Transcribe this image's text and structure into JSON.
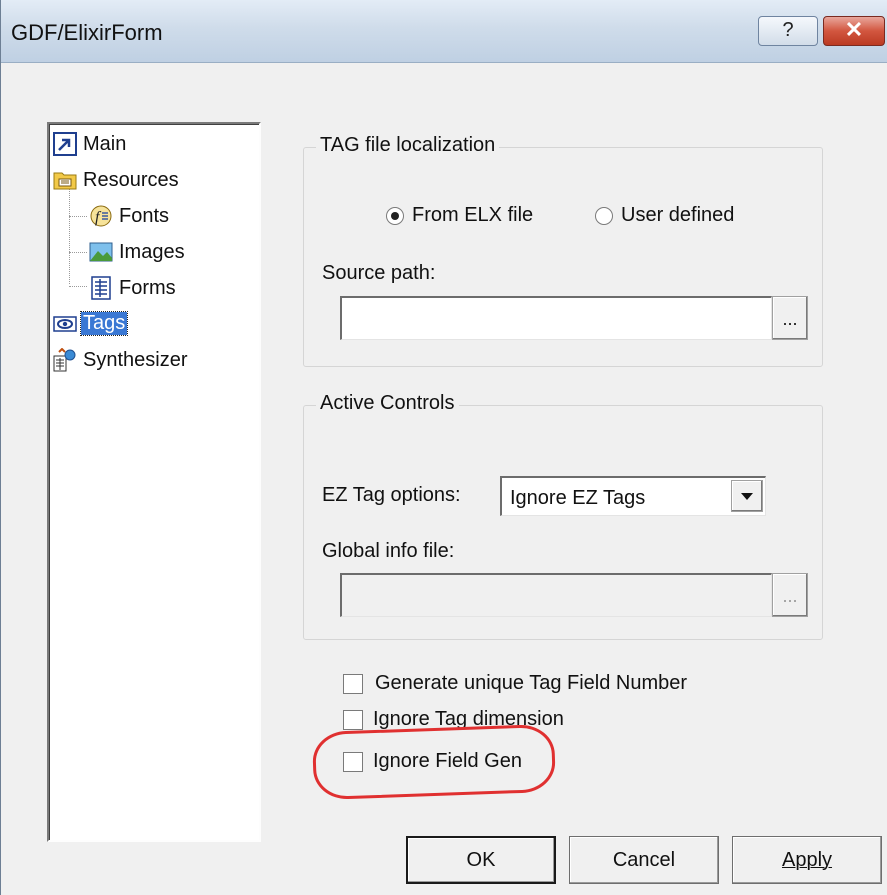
{
  "window": {
    "title": "GDF/ElixirForm",
    "help_glyph": "?",
    "close_glyph": "✕"
  },
  "tree": {
    "items": [
      {
        "label": "Main",
        "icon": "main-icon"
      },
      {
        "label": "Resources",
        "icon": "resources-icon"
      },
      {
        "label": "Fonts",
        "icon": "fonts-icon"
      },
      {
        "label": "Images",
        "icon": "images-icon"
      },
      {
        "label": "Forms",
        "icon": "forms-icon"
      },
      {
        "label": "Tags",
        "icon": "tags-icon",
        "selected": true
      },
      {
        "label": "Synthesizer",
        "icon": "synthesizer-icon"
      }
    ]
  },
  "tag_localization": {
    "title": "TAG file localization",
    "option_elx": "From ELX file",
    "option_user": "User defined",
    "selected": "From ELX file",
    "source_path_label": "Source path:",
    "source_path_value": "",
    "browse_label": "..."
  },
  "active_controls": {
    "title": "Active Controls",
    "ez_label": "EZ Tag options:",
    "ez_value": "Ignore EZ Tags",
    "global_label": "Global info file:",
    "global_value": "",
    "browse_label": "..."
  },
  "checkboxes": {
    "unique": "Generate unique Tag Field Number",
    "dimension": "Ignore Tag dimension",
    "fieldgen": "Ignore Field Gen"
  },
  "buttons": {
    "ok": "OK",
    "cancel": "Cancel",
    "apply": "Apply"
  },
  "colors": {
    "annotation": "#e03030",
    "selection": "#3a78d4"
  }
}
